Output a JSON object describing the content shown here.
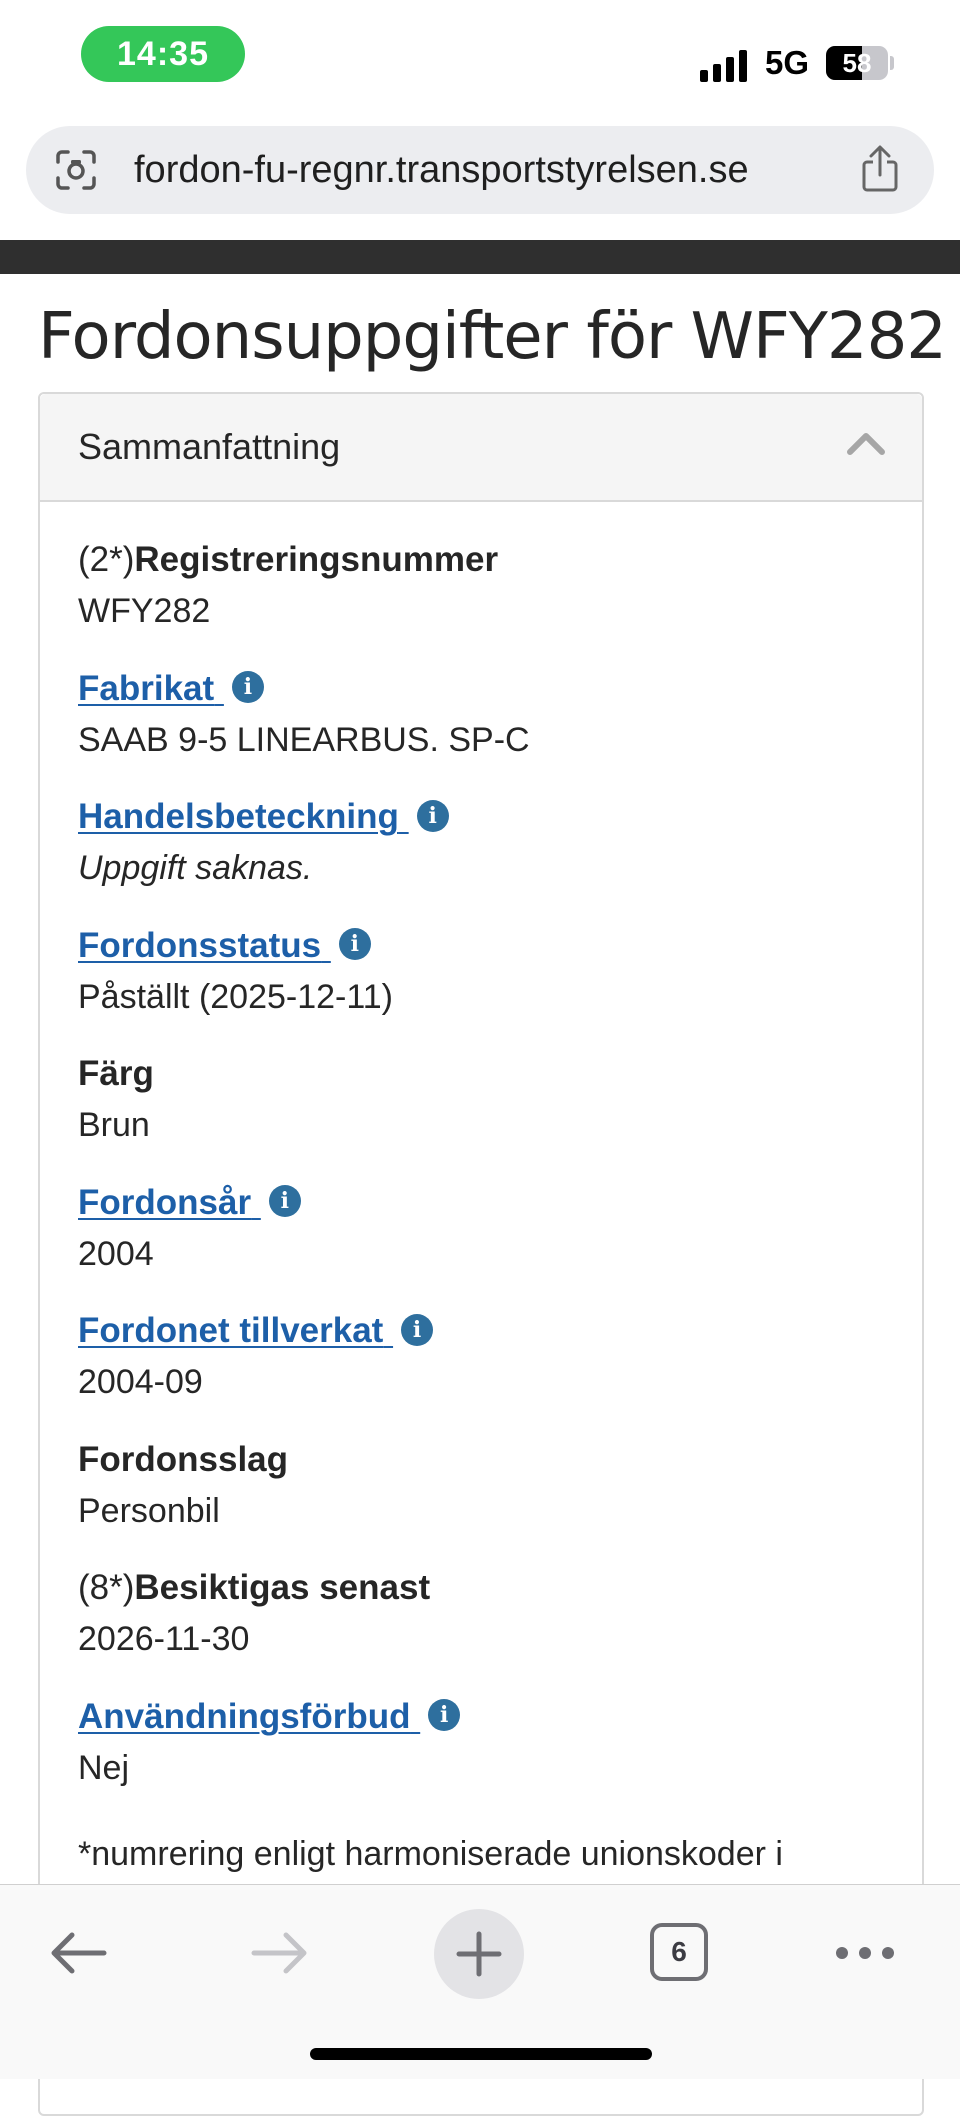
{
  "status_bar": {
    "time": "14:35",
    "network": "5G",
    "battery": "58",
    "battery_level": 0.58
  },
  "browser": {
    "url": "fordon-fu-regnr.transportstyrelsen.se",
    "tab_count": "6"
  },
  "page": {
    "title": "Fordonsuppgifter för WFY282",
    "panel_title": "Sammanfattning",
    "fields": [
      {
        "prefix": "(2*)",
        "label": "Registreringsnummer",
        "link": false,
        "value": "WFY282"
      },
      {
        "prefix": "",
        "label": "Fabrikat",
        "link": true,
        "value": "SAAB 9-5 LINEARBUS. SP-C"
      },
      {
        "prefix": "",
        "label": "Handelsbeteckning",
        "link": true,
        "value": "Uppgift saknas."
      },
      {
        "prefix": "",
        "label": "Fordonsstatus",
        "link": true,
        "value": "Påställt (2025-12-11)"
      },
      {
        "prefix": "",
        "label": "Färg",
        "link": false,
        "value": "Brun"
      },
      {
        "prefix": "",
        "label": "Fordonsår",
        "link": true,
        "value": "2004"
      },
      {
        "prefix": "",
        "label": "Fordonet tillverkat",
        "link": true,
        "value": "2004-09"
      },
      {
        "prefix": "",
        "label": "Fordonsslag",
        "link": false,
        "value": "Personbil"
      },
      {
        "prefix": "(8*)",
        "label": "Besiktigas senast",
        "link": false,
        "value": "2026-11-30"
      },
      {
        "prefix": "",
        "label": "Användningsförbud",
        "link": true,
        "value": "Nej"
      }
    ],
    "footnote": "*numrering enligt harmoniserade unionskoder i"
  },
  "icons": {
    "info": "info-icon",
    "collapse": "chevron-up-icon",
    "share": "share-icon",
    "url_left": "camera-scan-icon"
  },
  "colors": {
    "link": "#1d5fa8",
    "info_icon": "#2e6f9e",
    "time_pill": "#34c759"
  }
}
